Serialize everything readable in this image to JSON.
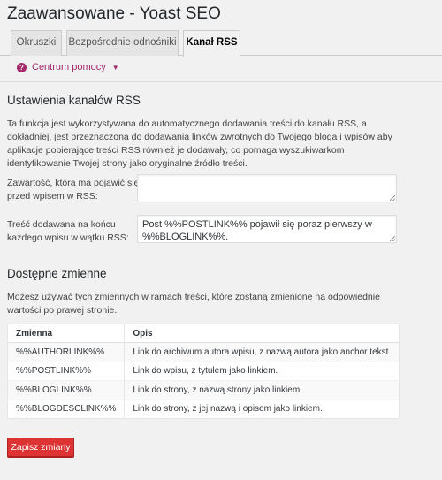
{
  "page_title": "Zaawansowane - Yoast SEO",
  "tabs": [
    {
      "label": "Okruszki",
      "active": false
    },
    {
      "label": "Bezpośrednie odnośniki",
      "active": false
    },
    {
      "label": "Kanał RSS",
      "active": true
    }
  ],
  "help": {
    "label": "Centrum pomocy",
    "icon": "question-circle-icon",
    "color": "#a4286a"
  },
  "rss_settings": {
    "heading": "Ustawienia kanałów RSS",
    "description": "Ta funkcja jest wykorzystywana do automatycznego dodawania treści do kanału RSS, a dokładniej, jest przeznaczona do dodawania linków zwrotnych do Twojego bloga i wpisów aby aplikacje pobierające treści RSS również je dodawały, co pomaga wyszukiwarkom identyfikowanie Twojej strony jako oryginalne źródło treści.",
    "before_label": "Zawartość, która ma pojawić się przed wpisem w RSS:",
    "before_value": "",
    "after_label": "Treść dodawana na końcu każdego wpisu w wątku RSS:",
    "after_value": "Post %%POSTLINK%% pojawił się poraz pierwszy w %%BLOGLINK%%."
  },
  "variables": {
    "heading": "Dostępne zmienne",
    "description": "Możesz używać tych zmiennych w ramach treści, które zostaną zmienione na odpowiednie wartości po prawej stronie.",
    "columns": [
      "Zmienna",
      "Opis"
    ],
    "rows": [
      [
        "%%AUTHORLINK%%",
        "Link do archiwum autora wpisu, z nazwą autora jako anchor tekst."
      ],
      [
        "%%POSTLINK%%",
        "Link do wpisu, z tytułem jako linkiem."
      ],
      [
        "%%BLOGLINK%%",
        "Link do strony, z nazwą strony jako linkiem."
      ],
      [
        "%%BLOGDESCLINK%%",
        "Link do strony, z jej nazwą i opisem jako linkiem."
      ]
    ]
  },
  "save_button": {
    "label": "Zapisz zmiany",
    "color": "#dd3333"
  }
}
